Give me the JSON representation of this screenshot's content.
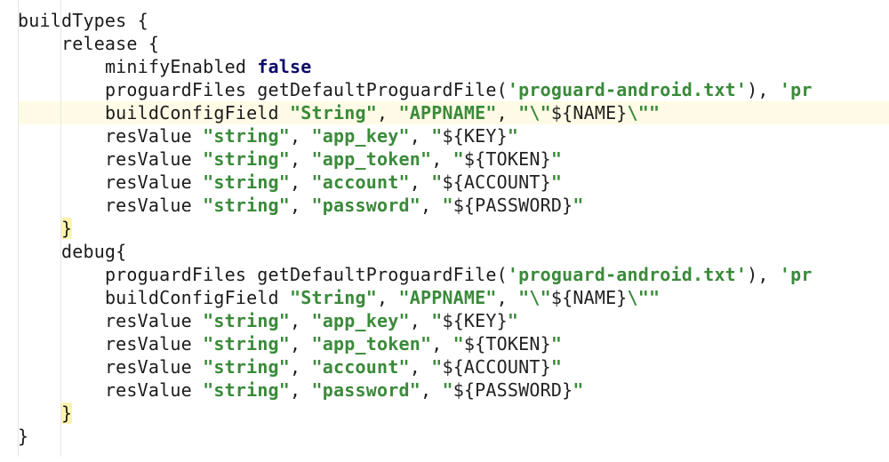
{
  "code": {
    "lines": [
      {
        "indent": 0,
        "parts": [
          [
            "",
            "buildTypes {"
          ]
        ]
      },
      {
        "indent": 1,
        "parts": [
          [
            "",
            "release {"
          ]
        ]
      },
      {
        "indent": 2,
        "parts": [
          [
            "",
            "minifyEnabled "
          ],
          [
            "kw-false",
            "false"
          ]
        ]
      },
      {
        "indent": 2,
        "parts": [
          [
            "",
            "proguardFiles getDefaultProguardFile("
          ],
          [
            "str",
            "'proguard-android.txt'"
          ],
          [
            "",
            ")"
          ],
          [
            "",
            ", "
          ],
          [
            "str",
            "'pr"
          ]
        ]
      },
      {
        "indent": 2,
        "hl": true,
        "parts": [
          [
            "",
            "buildConfigField "
          ],
          [
            "str",
            "\"String\""
          ],
          [
            "",
            ", "
          ],
          [
            "str",
            "\"APPNAME\""
          ],
          [
            "",
            ", "
          ],
          [
            "str",
            "\"\\\""
          ],
          [
            "strp",
            "${NAME}"
          ],
          [
            "str",
            "\\\"\""
          ]
        ]
      },
      {
        "indent": 2,
        "parts": [
          [
            "",
            "resValue "
          ],
          [
            "str",
            "\"string\""
          ],
          [
            "",
            ", "
          ],
          [
            "str",
            "\"app_key\""
          ],
          [
            "",
            ", "
          ],
          [
            "str",
            "\""
          ],
          [
            "strp",
            "${KEY}"
          ],
          [
            "str",
            "\""
          ]
        ]
      },
      {
        "indent": 2,
        "parts": [
          [
            "",
            "resValue "
          ],
          [
            "str",
            "\"string\""
          ],
          [
            "",
            ", "
          ],
          [
            "str",
            "\"app_token\""
          ],
          [
            "",
            ", "
          ],
          [
            "str",
            "\""
          ],
          [
            "strp",
            "${TOKEN}"
          ],
          [
            "str",
            "\""
          ]
        ]
      },
      {
        "indent": 2,
        "parts": [
          [
            "",
            "resValue "
          ],
          [
            "str",
            "\"string\""
          ],
          [
            "",
            ", "
          ],
          [
            "str",
            "\"account\""
          ],
          [
            "",
            ", "
          ],
          [
            "str",
            "\""
          ],
          [
            "strp",
            "${ACCOUNT}"
          ],
          [
            "str",
            "\""
          ]
        ]
      },
      {
        "indent": 2,
        "parts": [
          [
            "",
            "resValue "
          ],
          [
            "str",
            "\"string\""
          ],
          [
            "",
            ", "
          ],
          [
            "str",
            "\"password\""
          ],
          [
            "",
            ", "
          ],
          [
            "str",
            "\""
          ],
          [
            "strp",
            "${PASSWORD}"
          ],
          [
            "str",
            "\""
          ]
        ]
      },
      {
        "indent": 1,
        "parts": [
          [
            "brace",
            "}"
          ]
        ]
      },
      {
        "indent": 1,
        "parts": [
          [
            "",
            "debug{"
          ]
        ]
      },
      {
        "indent": 2,
        "parts": [
          [
            "",
            "proguardFiles getDefaultProguardFile("
          ],
          [
            "str",
            "'proguard-android.txt'"
          ],
          [
            "",
            ")"
          ],
          [
            "",
            ", "
          ],
          [
            "str",
            "'pr"
          ]
        ]
      },
      {
        "indent": 2,
        "parts": [
          [
            "",
            "buildConfigField "
          ],
          [
            "str",
            "\"String\""
          ],
          [
            "",
            ", "
          ],
          [
            "str",
            "\"APPNAME\""
          ],
          [
            "",
            ", "
          ],
          [
            "str",
            "\"\\\""
          ],
          [
            "strp",
            "${NAME}"
          ],
          [
            "str",
            "\\\"\""
          ]
        ]
      },
      {
        "indent": 2,
        "parts": [
          [
            "",
            "resValue "
          ],
          [
            "str",
            "\"string\""
          ],
          [
            "",
            ", "
          ],
          [
            "str",
            "\"app_key\""
          ],
          [
            "",
            ", "
          ],
          [
            "str",
            "\""
          ],
          [
            "strp",
            "${KEY}"
          ],
          [
            "str",
            "\""
          ]
        ]
      },
      {
        "indent": 2,
        "parts": [
          [
            "",
            "resValue "
          ],
          [
            "str",
            "\"string\""
          ],
          [
            "",
            ", "
          ],
          [
            "str",
            "\"app_token\""
          ],
          [
            "",
            ", "
          ],
          [
            "str",
            "\""
          ],
          [
            "strp",
            "${TOKEN}"
          ],
          [
            "str",
            "\""
          ]
        ]
      },
      {
        "indent": 2,
        "parts": [
          [
            "",
            "resValue "
          ],
          [
            "str",
            "\"string\""
          ],
          [
            "",
            ", "
          ],
          [
            "str",
            "\"account\""
          ],
          [
            "",
            ", "
          ],
          [
            "str",
            "\""
          ],
          [
            "strp",
            "${ACCOUNT}"
          ],
          [
            "str",
            "\""
          ]
        ]
      },
      {
        "indent": 2,
        "parts": [
          [
            "",
            "resValue "
          ],
          [
            "str",
            "\"string\""
          ],
          [
            "",
            ", "
          ],
          [
            "str",
            "\"password\""
          ],
          [
            "",
            ", "
          ],
          [
            "str",
            "\""
          ],
          [
            "strp",
            "${PASSWORD}"
          ],
          [
            "str",
            "\""
          ]
        ]
      },
      {
        "indent": 1,
        "parts": [
          [
            "brace",
            "}"
          ]
        ]
      },
      {
        "indent": 0,
        "parts": [
          [
            "",
            "}"
          ]
        ]
      }
    ],
    "indentUnit": "    ",
    "guideOffsets": [
      0,
      48
    ]
  }
}
